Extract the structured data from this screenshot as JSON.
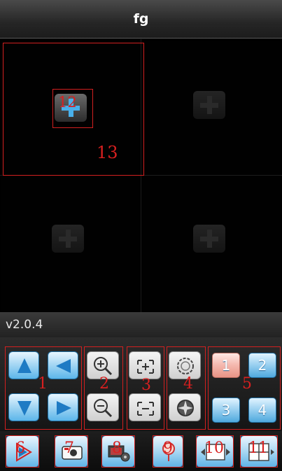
{
  "header": {
    "title": "fg"
  },
  "version": "v2.0.4",
  "annotations": [
    "1",
    "2",
    "3",
    "4",
    "5",
    "6",
    "7",
    "8",
    "9",
    "10",
    "11",
    "12",
    "13"
  ],
  "channels": [
    "1",
    "2",
    "3",
    "4"
  ],
  "colors": {
    "accent_blue": "#5cb6ea",
    "annotation_red": "#d32020",
    "selected_channel": "#f4b7ad"
  },
  "icons": {
    "ptz": [
      "arrow-up-icon",
      "arrow-left-icon",
      "arrow-down-icon",
      "arrow-right-icon"
    ],
    "zoom": [
      "zoom-in-icon",
      "zoom-out-icon"
    ],
    "focus": [
      "focus-near-icon",
      "focus-far-icon"
    ],
    "iris": [
      "iris-open-icon",
      "iris-close-icon"
    ],
    "toolbar": [
      "play-icon",
      "snapshot-icon",
      "record-settings-icon",
      "location-pin-icon",
      "single-view-icon",
      "quad-view-icon"
    ]
  }
}
